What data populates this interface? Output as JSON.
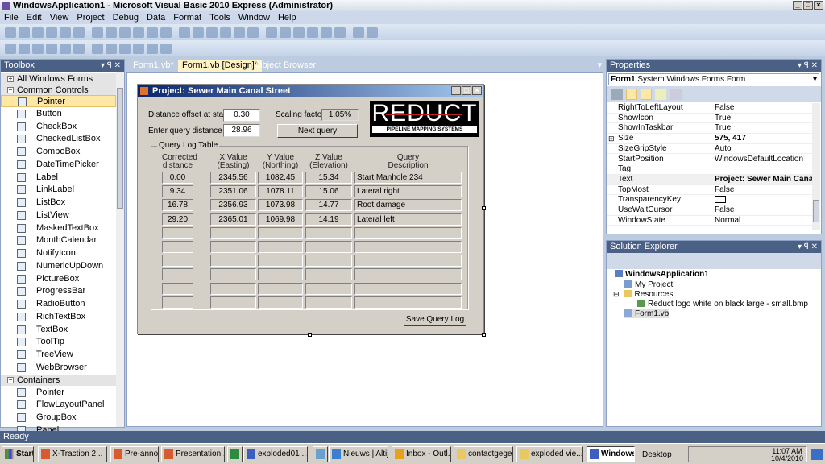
{
  "window": {
    "title": "WindowsApplication1 - Microsoft Visual Basic 2010 Express (Administrator)"
  },
  "menu": [
    "File",
    "Edit",
    "View",
    "Project",
    "Debug",
    "Data",
    "Format",
    "Tools",
    "Window",
    "Help"
  ],
  "toolbox": {
    "title": "Toolbox",
    "items": [
      {
        "type": "group",
        "label": "All Windows Forms",
        "expanded": false
      },
      {
        "type": "group",
        "label": "Common Controls",
        "expanded": true
      },
      {
        "label": "Pointer",
        "selected": true
      },
      {
        "label": "Button"
      },
      {
        "label": "CheckBox"
      },
      {
        "label": "CheckedListBox"
      },
      {
        "label": "ComboBox"
      },
      {
        "label": "DateTimePicker"
      },
      {
        "label": "Label"
      },
      {
        "label": "LinkLabel"
      },
      {
        "label": "ListBox"
      },
      {
        "label": "ListView"
      },
      {
        "label": "MaskedTextBox"
      },
      {
        "label": "MonthCalendar"
      },
      {
        "label": "NotifyIcon"
      },
      {
        "label": "NumericUpDown"
      },
      {
        "label": "PictureBox"
      },
      {
        "label": "ProgressBar"
      },
      {
        "label": "RadioButton"
      },
      {
        "label": "RichTextBox"
      },
      {
        "label": "TextBox"
      },
      {
        "label": "ToolTip"
      },
      {
        "label": "TreeView"
      },
      {
        "label": "WebBrowser"
      },
      {
        "type": "group",
        "label": "Containers",
        "expanded": true
      },
      {
        "label": "Pointer"
      },
      {
        "label": "FlowLayoutPanel"
      },
      {
        "label": "GroupBox"
      },
      {
        "label": "Panel"
      }
    ]
  },
  "doc_tabs": [
    {
      "label": "Form1.vb*"
    },
    {
      "label": "Form1.vb [Design]*",
      "active": true
    },
    {
      "label": "Object Browser"
    }
  ],
  "form": {
    "title": "Project: Sewer Main Canal Street",
    "offset_label": "Distance offset at start",
    "offset_value": "0.30",
    "query_label": "Enter query distance",
    "query_value": "28.96",
    "scaling_label": "Scaling factor",
    "scaling_value": "1.05%",
    "next_query": "Next query",
    "logo": {
      "brand": "REDUCT",
      "tagline": "PIPELINE MAPPING SYSTEMS"
    },
    "group_title": "Query Log Table",
    "headers": [
      [
        "Corrected",
        "distance"
      ],
      [
        "X Value",
        "(Easting)"
      ],
      [
        "Y Value",
        "(Northing)"
      ],
      [
        "Z Value",
        "(Elevation)"
      ],
      [
        "Query",
        "Description"
      ]
    ],
    "rows": [
      [
        "0.00",
        "2345.56",
        "1082.45",
        "15.34",
        "Start Manhole 234"
      ],
      [
        "9.34",
        "2351.06",
        "1078.11",
        "15.06",
        "Lateral right"
      ],
      [
        "16.78",
        "2356.93",
        "1073.98",
        "14.77",
        "Root damage"
      ],
      [
        "29.20",
        "2365.01",
        "1069.98",
        "14.19",
        "Lateral left"
      ],
      [
        "",
        "",
        "",
        "",
        ""
      ],
      [
        "",
        "",
        "",
        "",
        ""
      ],
      [
        "",
        "",
        "",
        "",
        ""
      ],
      [
        "",
        "",
        "",
        "",
        ""
      ],
      [
        "",
        "",
        "",
        "",
        ""
      ],
      [
        "",
        "",
        "",
        "",
        ""
      ]
    ],
    "save_button": "Save Query Log"
  },
  "properties": {
    "title": "Properties",
    "object": "Form1",
    "object_type": "System.Windows.Forms.Form",
    "rows": [
      [
        "RightToLeftLayout",
        "False"
      ],
      [
        "ShowIcon",
        "True"
      ],
      [
        "ShowInTaskbar",
        "True"
      ],
      [
        "Size",
        "575, 417"
      ],
      [
        "SizeGripStyle",
        "Auto"
      ],
      [
        "StartPosition",
        "WindowsDefaultLocation"
      ],
      [
        "Tag",
        ""
      ],
      [
        "Text",
        "Project: Sewer Main Canal Street"
      ],
      [
        "TopMost",
        "False"
      ],
      [
        "TransparencyKey",
        ""
      ],
      [
        "UseWaitCursor",
        "False"
      ],
      [
        "WindowState",
        "Normal"
      ]
    ]
  },
  "solution": {
    "title": "Solution Explorer",
    "project": "WindowsApplication1",
    "items": [
      "My Project",
      "Resources",
      "Reduct logo white on black large - small.bmp",
      "Form1.vb"
    ]
  },
  "status": "Ready",
  "taskbar": {
    "start": "Start",
    "tasks": [
      "X-Traction 2...",
      "Pre-announc...",
      "Presentation...",
      "",
      "exploded01 ...",
      "",
      "Nieuws | Altij...",
      "Inbox - Outl...",
      "contactgege...",
      "exploded vie...",
      "WindowsA..."
    ],
    "desktop": "Desktop",
    "time": "11:07 AM",
    "date": "10/4/2010"
  },
  "colors": {
    "title_bar": "#0a246a",
    "panel_header": "#4a6085",
    "selection": "#ffe8a6"
  }
}
